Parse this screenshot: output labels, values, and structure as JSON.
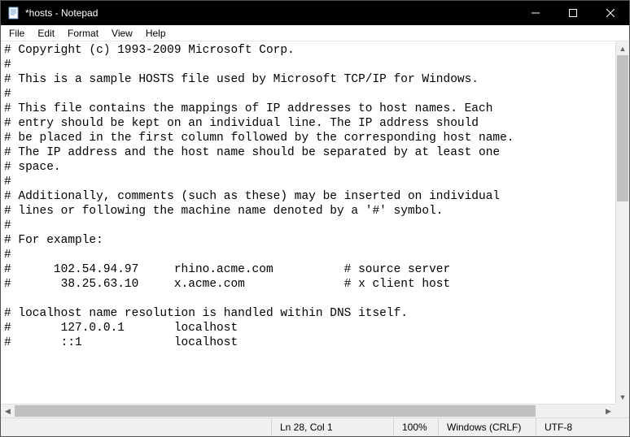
{
  "window": {
    "title": "*hosts - Notepad"
  },
  "menu": {
    "file": "File",
    "edit": "Edit",
    "format": "Format",
    "view": "View",
    "help": "Help"
  },
  "editor": {
    "content": "# Copyright (c) 1993-2009 Microsoft Corp.\n#\n# This is a sample HOSTS file used by Microsoft TCP/IP for Windows.\n#\n# This file contains the mappings of IP addresses to host names. Each\n# entry should be kept on an individual line. The IP address should\n# be placed in the first column followed by the corresponding host name.\n# The IP address and the host name should be separated by at least one\n# space.\n#\n# Additionally, comments (such as these) may be inserted on individual\n# lines or following the machine name denoted by a '#' symbol.\n#\n# For example:\n#\n#      102.54.94.97     rhino.acme.com          # source server\n#       38.25.63.10     x.acme.com              # x client host\n\n# localhost name resolution is handled within DNS itself.\n#       127.0.0.1       localhost\n#       ::1             localhost"
  },
  "status": {
    "position": "Ln 28, Col 1",
    "zoom": "100%",
    "line_ending": "Windows (CRLF)",
    "encoding": "UTF-8"
  }
}
